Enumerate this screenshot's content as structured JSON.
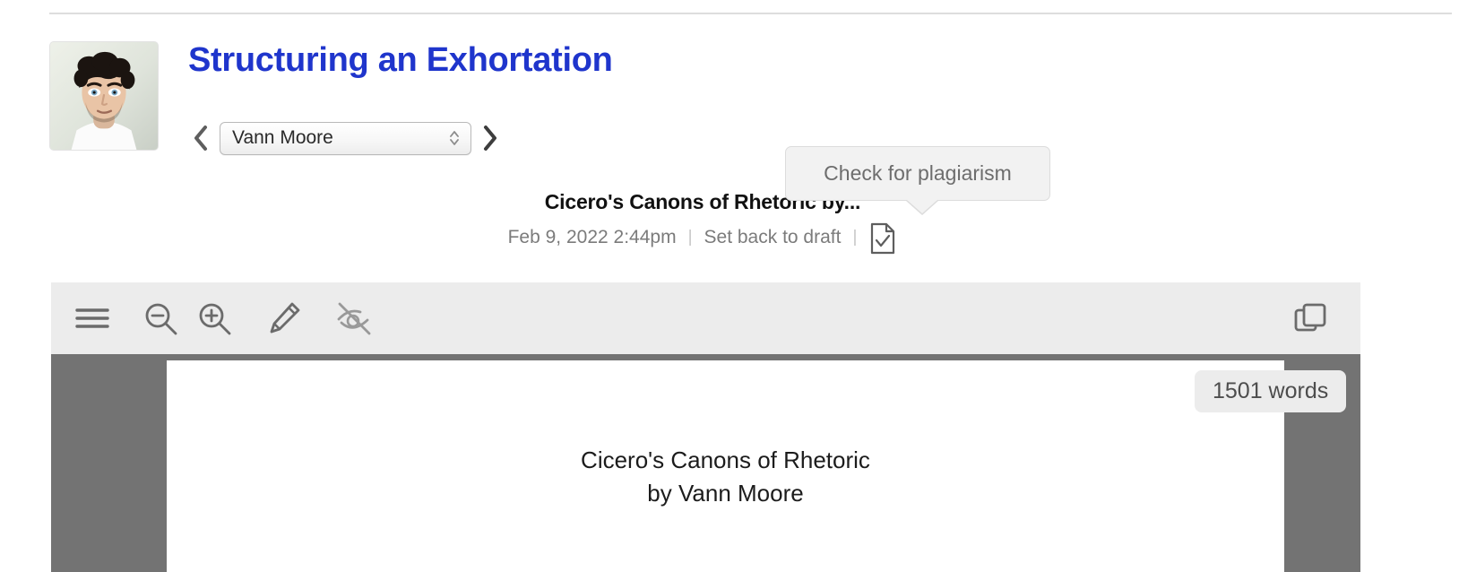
{
  "header": {
    "assignment_title": "Structuring an Exhortation",
    "title_color": "#1f35cc",
    "avatar_alt": "student-avatar"
  },
  "student_nav": {
    "prev_label": "‹",
    "next_label": "›",
    "selected_student": "Vann Moore",
    "options": [
      "Vann Moore"
    ]
  },
  "submission": {
    "name": "Cicero's Canons of Rhetoric by...",
    "timestamp": "Feb 9, 2022 2:44pm",
    "separator": "|",
    "status_action": "Set back to draft",
    "plagiarism_icon": "document-check-icon"
  },
  "tooltip": {
    "text": "Check for plagiarism"
  },
  "toolbar": {
    "icons": [
      {
        "name": "hamburger-menu-icon",
        "label": "Menu"
      },
      {
        "name": "zoom-out-icon",
        "label": "Zoom out"
      },
      {
        "name": "zoom-in-icon",
        "label": "Zoom in"
      },
      {
        "name": "pencil-edit-icon",
        "label": "Annotate"
      },
      {
        "name": "eye-slash-icon",
        "label": "Hide annotations"
      },
      {
        "name": "copy-duplicate-icon",
        "label": "Duplicate"
      }
    ],
    "background": "#ececec"
  },
  "document": {
    "title_line_1": "Cicero's Canons of Rhetoric",
    "title_line_2": "by Vann Moore",
    "page_background": "#ffffff",
    "viewer_background": "#737373"
  },
  "word_count": {
    "text": "1501 words"
  }
}
